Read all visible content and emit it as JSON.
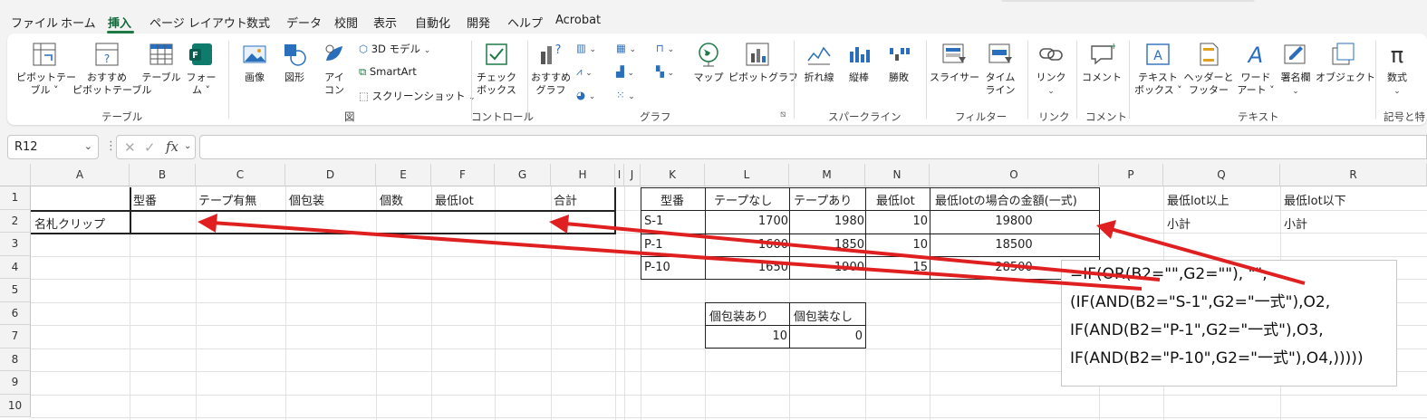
{
  "menu": {
    "items": [
      "ファイル",
      "ホーム",
      "挿入",
      "ページ レイアウト",
      "数式",
      "データ",
      "校閲",
      "表示",
      "自動化",
      "開発",
      "ヘルプ",
      "Acrobat"
    ],
    "active": "挿入"
  },
  "ribbon": {
    "table_group": {
      "pivot": "ピボットテー\nブル ˅",
      "rec_pivot": "おすすめ\nピボットテーブル",
      "table": "テーブル",
      "forms": "フォー\nム ˅",
      "label": "テーブル"
    },
    "illustrations": {
      "image": "画像",
      "shapes": "図形",
      "icons": "アイ\nコン",
      "model3d": "3D モデル",
      "smartart": "SmartArt",
      "screenshot": "スクリーンショット",
      "label": "図"
    },
    "controls": {
      "checkbox": "チェック\nボックス",
      "label": "コントロール"
    },
    "charts": {
      "rec_chart": "おすすめ\nグラフ",
      "map": "マップ",
      "pivot_chart": "ピボットグラフ",
      "label": "グラフ"
    },
    "sparklines": {
      "line": "折れ線",
      "column": "縦棒",
      "winloss": "勝敗",
      "label": "スパークライン"
    },
    "filters": {
      "slicer": "スライサー",
      "timeline": "タイム\nライン",
      "label": "フィルター"
    },
    "links": {
      "link": "リンク",
      "label": "リンク"
    },
    "comments": {
      "comment": "コメント",
      "label": "コメント"
    },
    "text": {
      "textbox": "テキスト\nボックス ˅",
      "header": "ヘッダーと\nフッター",
      "wordart": "ワード\nアート ˅",
      "signature": "署名欄",
      "object": "オブジェクト",
      "label": "テキスト"
    },
    "symbols": {
      "equation": "数式",
      "label": "記号と特"
    }
  },
  "formula_bar": {
    "name_box": "R12",
    "fx": "fx",
    "formula": ""
  },
  "columns": [
    "A",
    "B",
    "C",
    "D",
    "E",
    "F",
    "G",
    "H",
    "I",
    "J",
    "K",
    "L",
    "M",
    "N",
    "O",
    "P",
    "Q",
    "R"
  ],
  "rows": [
    "1",
    "2",
    "3",
    "4",
    "5",
    "6",
    "7",
    "8",
    "9",
    "10"
  ],
  "table1": {
    "headers": [
      "型番",
      "テープ有無",
      "個包装",
      "個数",
      "最低lot",
      "合計"
    ],
    "row_label": "名札クリップ"
  },
  "table2": {
    "headers": [
      "型番",
      "テープなし",
      "テープあり",
      "最低lot",
      "最低lotの場合の金額(一式)"
    ],
    "rows": [
      [
        "S-1",
        "1700",
        "1980",
        "10",
        "19800"
      ],
      [
        "P-1",
        "1600",
        "1850",
        "10",
        "18500"
      ],
      [
        "P-10",
        "1650",
        "1900",
        "15",
        "28500"
      ]
    ]
  },
  "table3": {
    "headers": [
      "個包装あり",
      "個包装なし"
    ],
    "values": [
      "10",
      "0"
    ]
  },
  "side": {
    "q1": "最低lot以上",
    "r1": "最低lot以下",
    "q2": "小計",
    "r2": "小計"
  },
  "callout_lines": [
    "=IF(OR(B2=\"\",G2=\"\"), \"\",",
    "(IF(AND(B2=\"S-1\",G2=\"一式\"),O2,",
    "IF(AND(B2=\"P-1\",G2=\"一式\"),O3,",
    "IF(AND(B2=\"P-10\",G2=\"一式\"),O4,)))))"
  ],
  "colors": {
    "accent": "#1f7a45",
    "arrow": "#e02020"
  }
}
